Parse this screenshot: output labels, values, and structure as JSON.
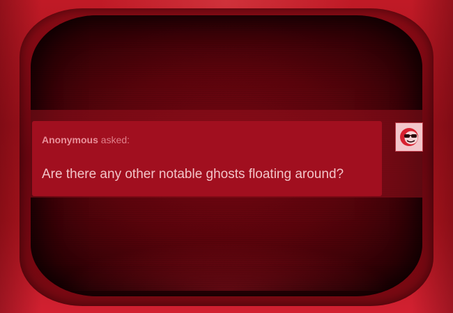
{
  "post": {
    "asker_name": "Anonymous",
    "asker_verb": "asked:",
    "question": "Are there any other notable ghosts floating around?"
  },
  "avatar": {
    "icon": "sunglasses-smiley-icon"
  },
  "colors": {
    "frame": "#c01a26",
    "screen": "#5c040c",
    "card": "#a10f1f",
    "text": "#f2c4c8",
    "asker": "#e8909a"
  }
}
